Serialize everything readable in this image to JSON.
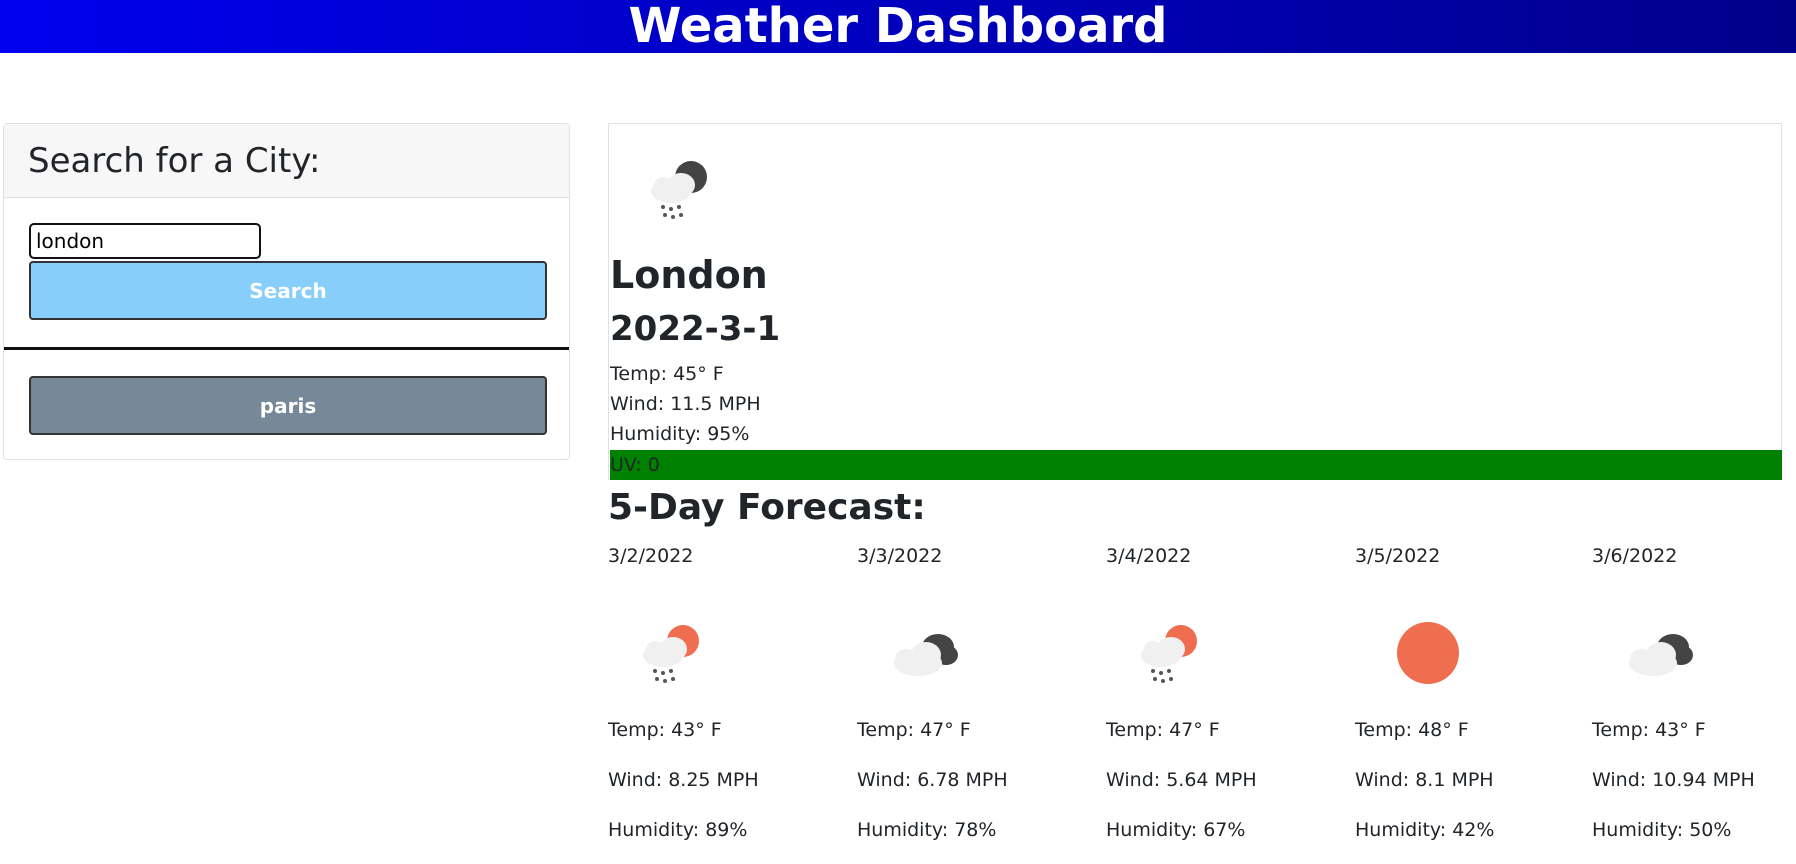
{
  "header": {
    "title": "Weather Dashboard"
  },
  "search": {
    "title": "Search for a City:",
    "input_value": "london",
    "button_label": "Search"
  },
  "history": [
    "paris"
  ],
  "current": {
    "icon": "rain-night-icon",
    "city": "London",
    "date": "2022-3-1",
    "temp": "Temp: 45° F",
    "wind": "Wind: 11.5 MPH",
    "humidity": "Humidity: 95%",
    "uv": "UV: 0",
    "uv_color": "#008000"
  },
  "forecast": {
    "title": "5-Day Forecast:",
    "days": [
      {
        "date": "3/2/2022",
        "icon": "rain-sun-icon",
        "temp": "Temp: 43° F",
        "wind": "Wind: 8.25 MPH",
        "humidity": "Humidity: 89%"
      },
      {
        "date": "3/3/2022",
        "icon": "cloudy-icon",
        "temp": "Temp: 47° F",
        "wind": "Wind: 6.78 MPH",
        "humidity": "Humidity: 78%"
      },
      {
        "date": "3/4/2022",
        "icon": "rain-sun-icon",
        "temp": "Temp: 47° F",
        "wind": "Wind: 5.64 MPH",
        "humidity": "Humidity: 67%"
      },
      {
        "date": "3/5/2022",
        "icon": "sun-icon",
        "temp": "Temp: 48° F",
        "wind": "Wind: 8.1 MPH",
        "humidity": "Humidity: 42%"
      },
      {
        "date": "3/6/2022",
        "icon": "cloudy-icon",
        "temp": "Temp: 43° F",
        "wind": "Wind: 10.94 MPH",
        "humidity": "Humidity: 50%"
      }
    ]
  },
  "colors": {
    "header_start": "#0000ee",
    "header_end": "#00008a",
    "search_button": "#87cefa",
    "history_button": "#778899",
    "sun": "#ee6e4f"
  }
}
